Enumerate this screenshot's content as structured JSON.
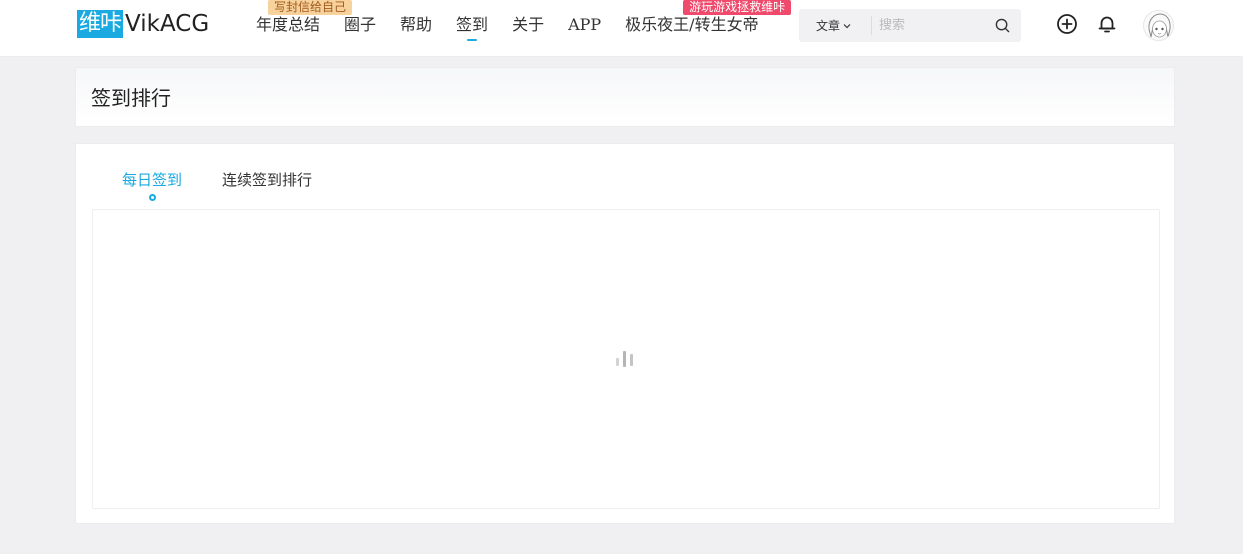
{
  "header": {
    "logo": {
      "cn": "维咔",
      "en": "VikACG"
    },
    "nav": [
      {
        "label": "年度总结",
        "badge": "写封信给自己",
        "badge_color": "#f7d29c"
      },
      {
        "label": "圈子"
      },
      {
        "label": "帮助"
      },
      {
        "label": "签到",
        "active": true
      },
      {
        "label": "关于"
      },
      {
        "label": "APP"
      },
      {
        "label": "极乐夜王/转生女帝",
        "badge": "游玩游戏拯救维咔",
        "badge_color": "#ef4a6c"
      }
    ],
    "search": {
      "type_label": "文章",
      "placeholder": "搜索"
    },
    "icons": [
      "plus-circle-icon",
      "bell-icon",
      "avatar"
    ]
  },
  "title_card": {
    "title": "签到排行"
  },
  "main": {
    "tabs": [
      {
        "label": "每日签到",
        "active": true
      },
      {
        "label": "连续签到排行"
      }
    ]
  },
  "colors": {
    "accent": "#1aa9e0",
    "background": "#f0f0f2"
  }
}
